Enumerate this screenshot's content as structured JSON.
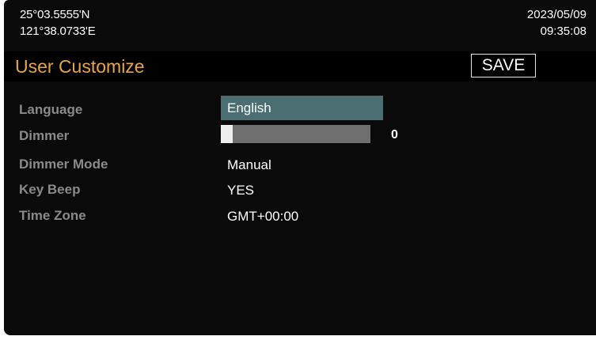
{
  "status": {
    "latitude": "25°03.5555'N",
    "longitude": "121°38.0733'E",
    "date": "2023/05/09",
    "time": "09:35:08"
  },
  "header": {
    "title": "User Customize",
    "save_label": "SAVE"
  },
  "settings": [
    {
      "label": "Language",
      "value": "English"
    },
    {
      "label": "Dimmer",
      "value": "0",
      "level_fraction": 0.08
    },
    {
      "label": "Dimmer Mode",
      "value": "Manual"
    },
    {
      "label": "Key Beep",
      "value": "YES"
    },
    {
      "label": "Time Zone",
      "value": "GMT+00:00"
    }
  ],
  "colors": {
    "title": "#e8a449",
    "label": "#8a8a8a",
    "selected_bg": "#4a6e71",
    "background": "#0a0a0a"
  }
}
